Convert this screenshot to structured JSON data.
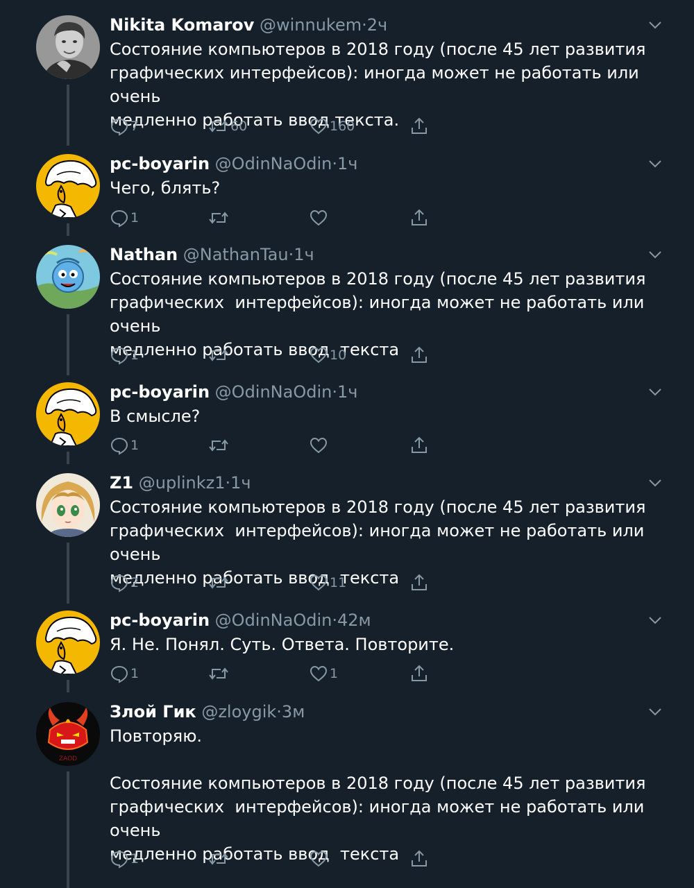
{
  "tweets": [
    {
      "name": "Nikita Komarov",
      "handle": "@winnukem",
      "dot": "·",
      "time": "2ч",
      "text": "Состояние компьютеров в 2018 году (после 45 лет развития\nграфических интерфейсов): иногда может не работать или очень\nмедленно работать ввод текста.",
      "replies": "7",
      "retweets": "60",
      "likes": "160",
      "avatar": "photo-avatar"
    },
    {
      "name": "pc-boyarin",
      "handle": "@OdinNaOdin",
      "dot": "·",
      "time": "1ч",
      "text": "Чего, блять?",
      "replies": "1",
      "retweets": "",
      "likes": "",
      "avatar": "boyarin-avatar"
    },
    {
      "name": "Nathan",
      "handle": "@NathanTau",
      "dot": "·",
      "time": "1ч",
      "text": "Состояние компьютеров в 2018 году (после 45 лет развития\nграфических  интерфейсов): иногда может не работать или очень\nмедленно работать ввод  текста",
      "replies": "1",
      "retweets": "",
      "likes": "10",
      "avatar": "cartoon-avatar"
    },
    {
      "name": "pc-boyarin",
      "handle": "@OdinNaOdin",
      "dot": "·",
      "time": "1ч",
      "text": "В смысле?",
      "replies": "1",
      "retweets": "",
      "likes": "",
      "avatar": "boyarin-avatar"
    },
    {
      "name": "Z1",
      "handle": "@uplinkz1",
      "dot": "·",
      "time": "1ч",
      "text": "Состояние компьютеров в 2018 году (после 45 лет развития\nграфических  интерфейсов): иногда может не работать или очень\nмедленно работать ввод  текста",
      "replies": "2",
      "retweets": "",
      "likes": "11",
      "avatar": "anime-avatar"
    },
    {
      "name": "pc-boyarin",
      "handle": "@OdinNaOdin",
      "dot": "·",
      "time": "42м",
      "text": "Я. Не. Понял. Суть. Ответа. Повторите.",
      "replies": "1",
      "retweets": "",
      "likes": "1",
      "avatar": "boyarin-avatar"
    },
    {
      "name": "Злой Гик",
      "handle": "@zloygik",
      "dot": "·",
      "time": "3м",
      "text": "Повторяю.\n\nСостояние компьютеров в 2018 году (после 45 лет развития\nграфических  интерфейсов): иногда может не работать или очень\nмедленно работать ввод  текста",
      "replies": "1",
      "retweets": "",
      "likes": "",
      "avatar": "demon-avatar",
      "avatar_caption": "ZAOD"
    }
  ],
  "colors": {
    "background": "#15202b",
    "secondary_text": "#8899a6",
    "thread_line": "#38444d"
  }
}
